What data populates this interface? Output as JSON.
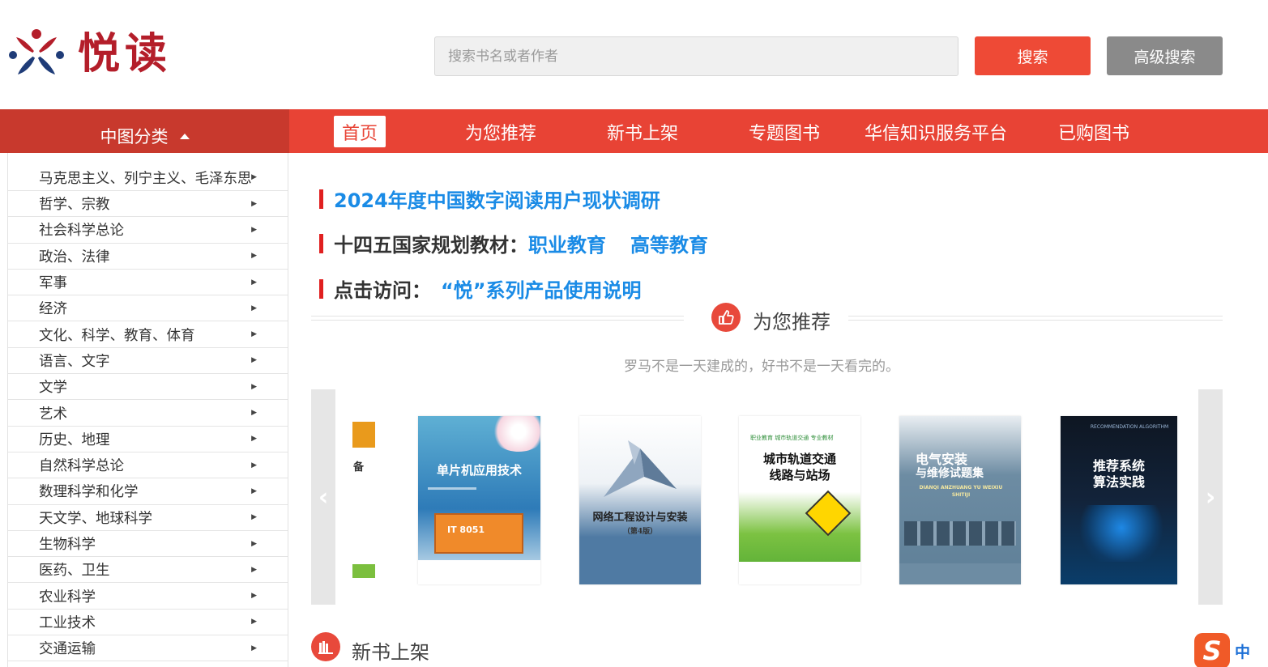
{
  "header": {
    "logo_text": "悦读",
    "search_placeholder": "搜索书名或者作者",
    "search_button": "搜索",
    "advanced_search_button": "高级搜索"
  },
  "nav": {
    "category_toggle": "中图分类",
    "items": [
      {
        "label": "首页",
        "active": true
      },
      {
        "label": "为您推荐",
        "active": false
      },
      {
        "label": "新书上架",
        "active": false
      },
      {
        "label": "专题图书",
        "active": false
      },
      {
        "label": "华信知识服务平台",
        "active": false
      },
      {
        "label": "已购图书",
        "active": false
      }
    ]
  },
  "sidebar": {
    "items": [
      {
        "label": "马克思主义、列宁主义、毛泽东思"
      },
      {
        "label": "哲学、宗教"
      },
      {
        "label": "社会科学总论"
      },
      {
        "label": "政治、法律"
      },
      {
        "label": "军事"
      },
      {
        "label": "经济"
      },
      {
        "label": "文化、科学、教育、体育"
      },
      {
        "label": "语言、文字"
      },
      {
        "label": "文学"
      },
      {
        "label": "艺术"
      },
      {
        "label": "历史、地理"
      },
      {
        "label": "自然科学总论"
      },
      {
        "label": "数理科学和化学"
      },
      {
        "label": "天文学、地球科学"
      },
      {
        "label": "生物科学"
      },
      {
        "label": "医药、卫生"
      },
      {
        "label": "农业科学"
      },
      {
        "label": "工业技术"
      },
      {
        "label": "交通运输"
      }
    ]
  },
  "announcements": {
    "survey_link": "2024年度中国数字阅读用户现状调研",
    "textbook_label": "十四五国家规划教材：",
    "vocational_link": "职业教育",
    "higher_link": "高等教育",
    "visit_label": "点击访问：",
    "guide_link": "“悦”系列产品使用说明"
  },
  "recommend": {
    "title": "为您推荐",
    "subtitle": "罗马不是一天建成的，好书不是一天看完的。",
    "partial_book_text": "备",
    "books": [
      {
        "title": "单片机应用技术",
        "badge": "IT 8051"
      },
      {
        "title": "网络工程设计与安装",
        "edition": "（第4版）"
      },
      {
        "title_line1": "城市轨道交通",
        "title_line2": "线路与站场",
        "series": "职业教育 城市轨道交通 专业教材"
      },
      {
        "title_line1": "电气安装",
        "title_line2": "与维修试题集",
        "pinyin": "DIANQI ANZHUANG YU WEIXIU SHITIJI"
      },
      {
        "title_line1": "推荐系统",
        "title_line2": "算法实践",
        "english": "RECOMMENDATION ALGORITHM"
      }
    ]
  },
  "new_books": {
    "title": "新书上架"
  },
  "ime": {
    "logo": "S",
    "mode": "中"
  },
  "colors": {
    "primary_red": "#e84335",
    "category_red": "#c8392d",
    "link_blue": "#1a8be6",
    "logo_red": "#b41e2a"
  }
}
